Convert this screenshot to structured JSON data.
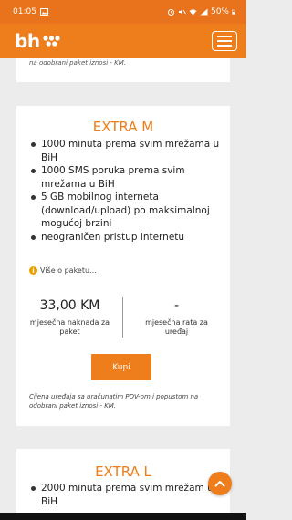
{
  "status_bar": {
    "time": "01:05",
    "battery": "50%"
  },
  "header": {
    "logo_text": "bh"
  },
  "top_card": {
    "note": "na odobrani paket iznosi - KM."
  },
  "plans": [
    {
      "title": "EXTRA M",
      "features": [
        "1000 minuta prema svim mrežama u BiH",
        "1000 SMS poruka prema svim mrežama u BiH",
        "5 GB mobilnog interneta (download/upload) po maksimalnoj mogućoj brzini",
        "neograničen pristup internetu"
      ],
      "more_label": "Više o paketu...",
      "price_value": "33,00 KM",
      "price_label": "mjesečna naknada za paket",
      "installment_value": "-",
      "installment_label": "mjesečna rata za uređaj",
      "buy_label": "Kupi",
      "disclaimer": "Cijena uređaja sa uračunatim PDV-om i popustom na odobrani paket iznosi - KM."
    },
    {
      "title": "EXTRA L",
      "features": [
        "2000 minuta prema svim mrežam u BiH"
      ]
    }
  ],
  "colors": {
    "brand_orange": "#ee7d1c",
    "page_background": "#ececec",
    "info_icon": "#e8a100"
  },
  "icons": {
    "info": "info-icon",
    "scroll_top": "chevron-up-icon",
    "menu": "hamburger-menu-icon"
  }
}
